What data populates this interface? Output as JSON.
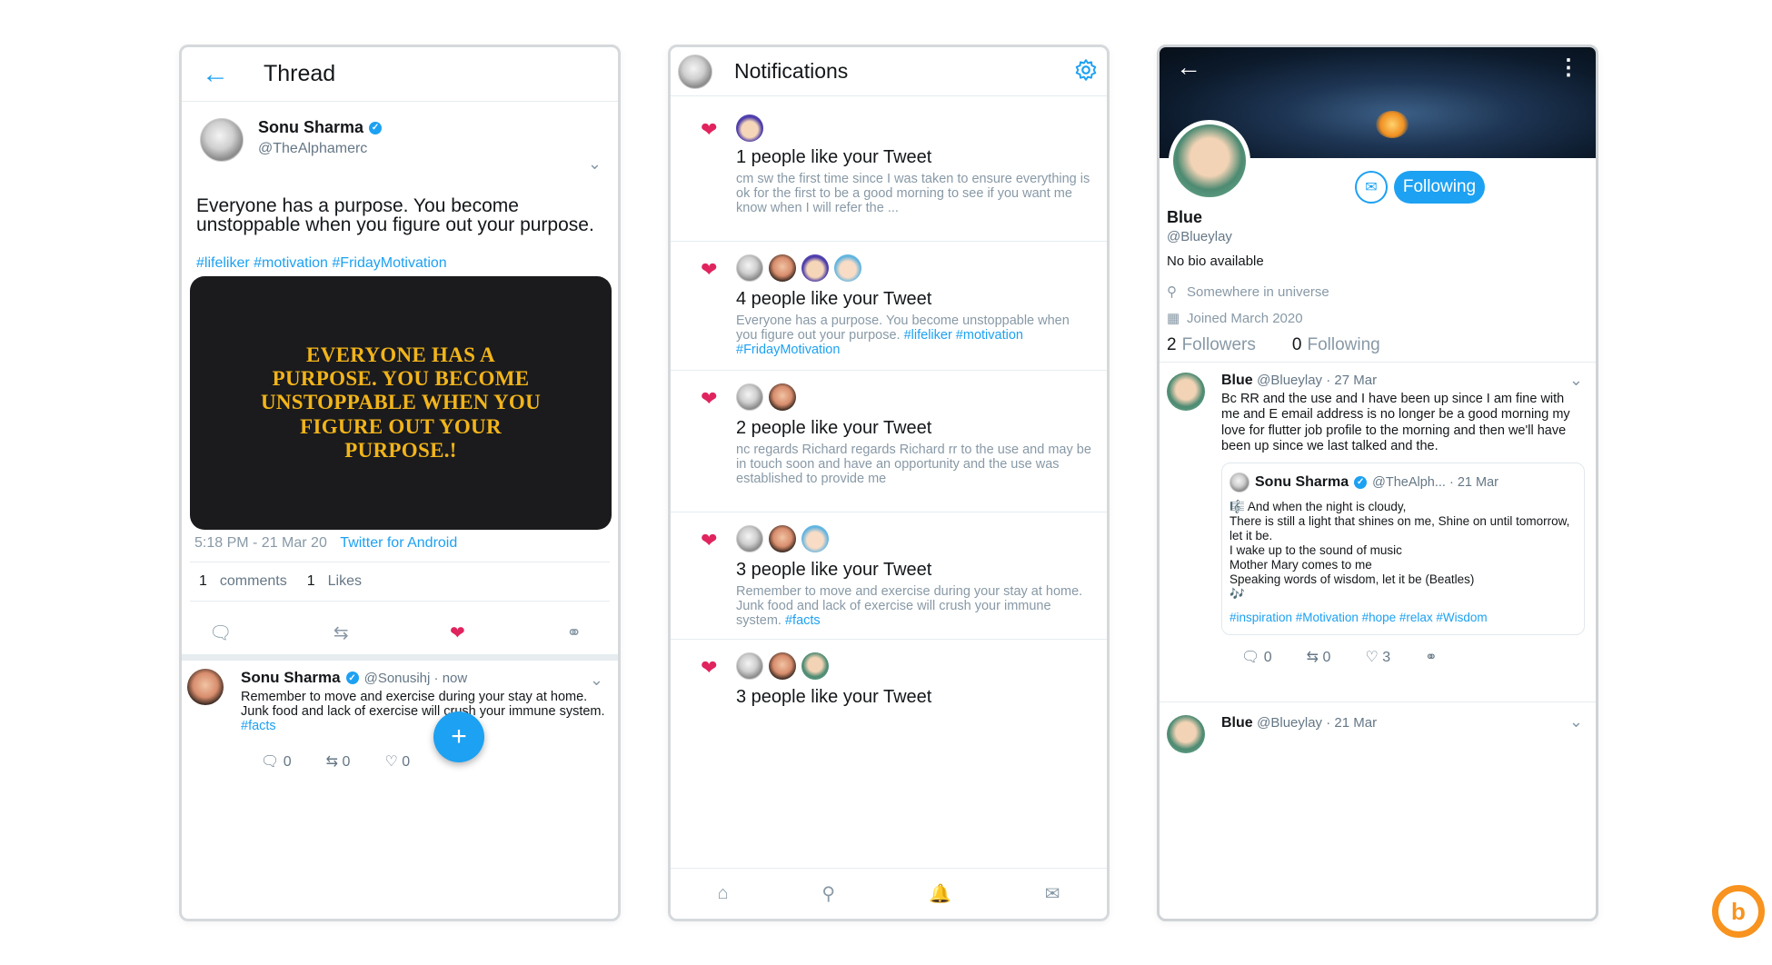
{
  "thread": {
    "back_icon": "arrow-left-icon",
    "title": "Thread",
    "author_name": "Sonu Sharma",
    "author_handle": "@TheAlphamerc",
    "text": "Everyone has a purpose. You become unstoppable when you figure out your purpose.",
    "hashtags": "#lifeliker #motivation #FridayMotivation",
    "image_text": "EVERYONE HAS A PURPOSE. YOU BECOME UNSTOPPABLE WHEN YOU FIGURE OUT YOUR PURPOSE.!",
    "timestamp": "5:18 PM - 21 Mar 20",
    "source": "Twitter for Android",
    "comments_count": "1",
    "comments_label": "comments",
    "likes_count": "1",
    "likes_label": "Likes",
    "reply": {
      "name": "Sonu Sharma",
      "handle": "@Sonusihj · now",
      "text": "Remember to move and exercise  during your stay at home. Junk food and lack of exercise will crush your immune system.",
      "hashtag": "#facts",
      "comments": "0",
      "retweets": "0",
      "likes": "0"
    },
    "fab_label": "+"
  },
  "notifications": {
    "title": "Notifications",
    "items": [
      {
        "title": "1 people like your Tweet",
        "body": "cm sw the first time since I was taken to ensure everything is ok for the first to be a good morning to see if you want me know when I will refer the ...",
        "tags": ""
      },
      {
        "title": "4 people like your Tweet",
        "body": "Everyone has a purpose. You become unstoppable when you figure out your purpose.",
        "tags": "#lifeliker #motivation #FridayMotivation"
      },
      {
        "title": "2 people like your Tweet",
        "body": "nc regards Richard regards Richard rr to the use and may be in touch soon and have an opportunity and the use was established to provide me",
        "tags": ""
      },
      {
        "title": "3 people like your Tweet",
        "body": "Remember to move and exercise  during your stay at home. Junk food and lack of exercise will crush your immune system.",
        "tags": "#facts"
      },
      {
        "title": "3 people like your Tweet",
        "body": "",
        "tags": ""
      }
    ],
    "nav": [
      "home-icon",
      "search-icon",
      "bell-icon",
      "mail-icon"
    ]
  },
  "profile": {
    "name": "Blue",
    "handle": "@Blueylay",
    "bio": "No bio available",
    "location": "Somewhere in universe",
    "joined": "Joined March 2020",
    "followers_count": "2",
    "followers_label": "Followers",
    "following_count": "0",
    "following_label": "Following",
    "follow_button": "Following",
    "tweet1": {
      "name": "Blue",
      "meta": "@Blueylay · 27 Mar",
      "text": "Bc RR and the use and I have been up since I am fine with me and E email address is no longer be a good morning my love for flutter job profile to the morning and then we'll have been up since we last talked and the.",
      "quote_name": "Sonu Sharma",
      "quote_meta": "@TheAlph... · 21 Mar",
      "quote_text": "🎼 And when the night is cloudy,\nThere is still a light that shines on me, Shine on until tomorrow, let it be.\nI wake up to the sound of music\nMother Mary comes to me\nSpeaking words of wisdom, let it be (Beatles)\n🎶",
      "quote_tags": "#inspiration #Motivation #hope #relax #Wisdom",
      "comments": "0",
      "retweets": "0",
      "likes": "3"
    },
    "tweet2": {
      "name": "Blue",
      "meta": "@Blueylay · 21 Mar"
    }
  },
  "colors": {
    "accent": "#1da1f2",
    "like": "#e0245e",
    "logo": "#f7931e"
  }
}
